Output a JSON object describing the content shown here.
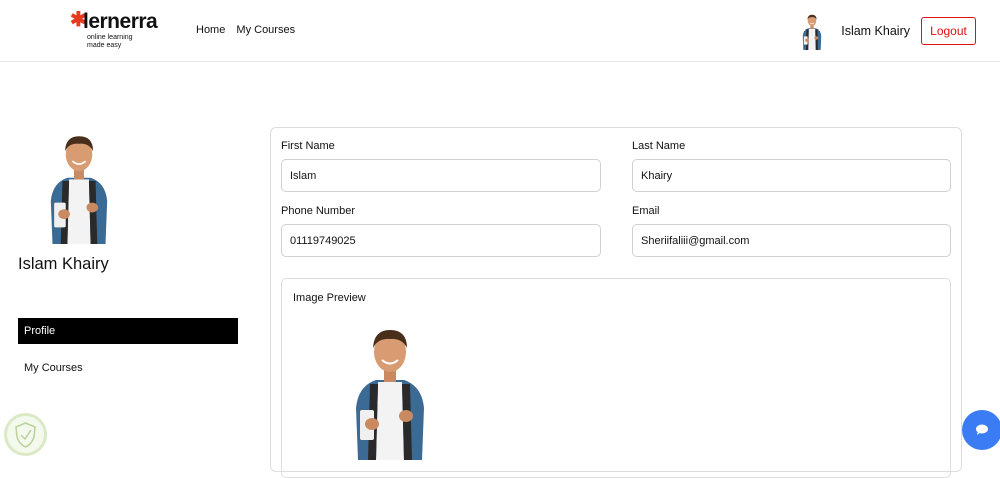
{
  "brand": {
    "name": "lernerra",
    "tagline_line1": "online learning",
    "tagline_line2": "made easy",
    "accent": "#e63b1f"
  },
  "nav": {
    "home": "Home",
    "my_courses": "My Courses"
  },
  "header_user": {
    "name": "Islam Khairy",
    "logout_label": "Logout"
  },
  "sidebar": {
    "name": "Islam Khairy",
    "items": [
      {
        "label": "Profile",
        "active": true
      },
      {
        "label": "My Courses",
        "active": false
      }
    ]
  },
  "form": {
    "first_name": {
      "label": "First Name",
      "value": "Islam"
    },
    "last_name": {
      "label": "Last Name",
      "value": "Khairy"
    },
    "phone": {
      "label": "Phone Number",
      "value": "01119749025"
    },
    "email": {
      "label": "Email",
      "value": "Sheriifaliii@gmail.com"
    }
  },
  "preview": {
    "title": "Image Preview"
  },
  "icons": {
    "chat": "chat-bubble-icon",
    "badge": "shield-badge-icon"
  },
  "colors": {
    "logout": "#dd1111",
    "active_menu_bg": "#000000",
    "chat_button": "#3b7cf5"
  }
}
